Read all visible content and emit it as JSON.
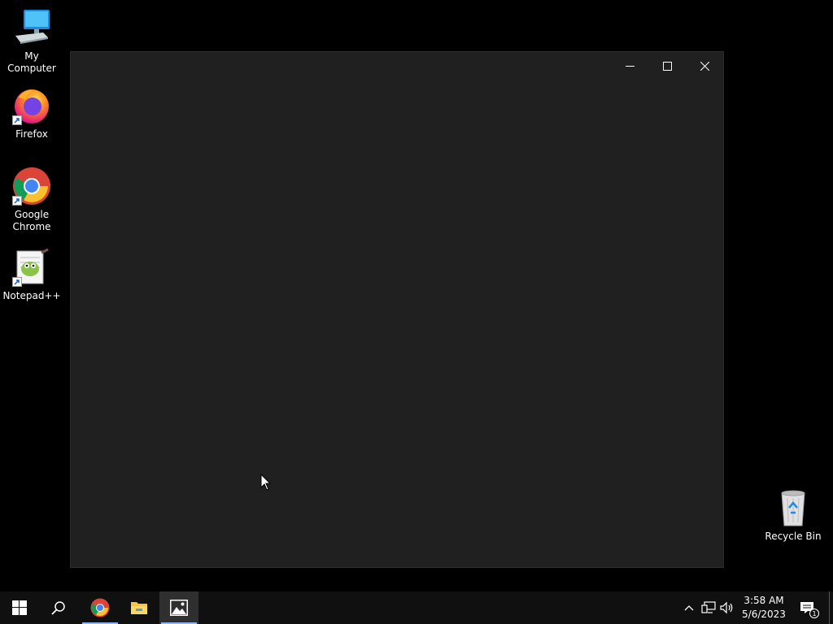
{
  "desktop": {
    "icons": [
      {
        "label": "My Computer",
        "icon": "computer-icon"
      },
      {
        "label": "Firefox",
        "icon": "firefox-icon"
      },
      {
        "label": "Google\nChrome",
        "icon": "chrome-icon"
      },
      {
        "label": "Notepad++",
        "icon": "notepadpp-icon"
      },
      {
        "label": "Recycle Bin",
        "icon": "recycle-bin-icon"
      }
    ]
  },
  "window": {
    "background": "#202020",
    "controls": [
      "minimize",
      "maximize",
      "close"
    ]
  },
  "taskbar": {
    "pinned": [
      "start-icon",
      "search-icon",
      "chrome-icon",
      "file-explorer-icon",
      "photos-icon"
    ],
    "active_app": "photos-icon",
    "accent": "#8ab4f8",
    "clock": {
      "time": "3:58 AM",
      "date": "5/6/2023"
    },
    "notifications": {
      "count": "1"
    }
  }
}
